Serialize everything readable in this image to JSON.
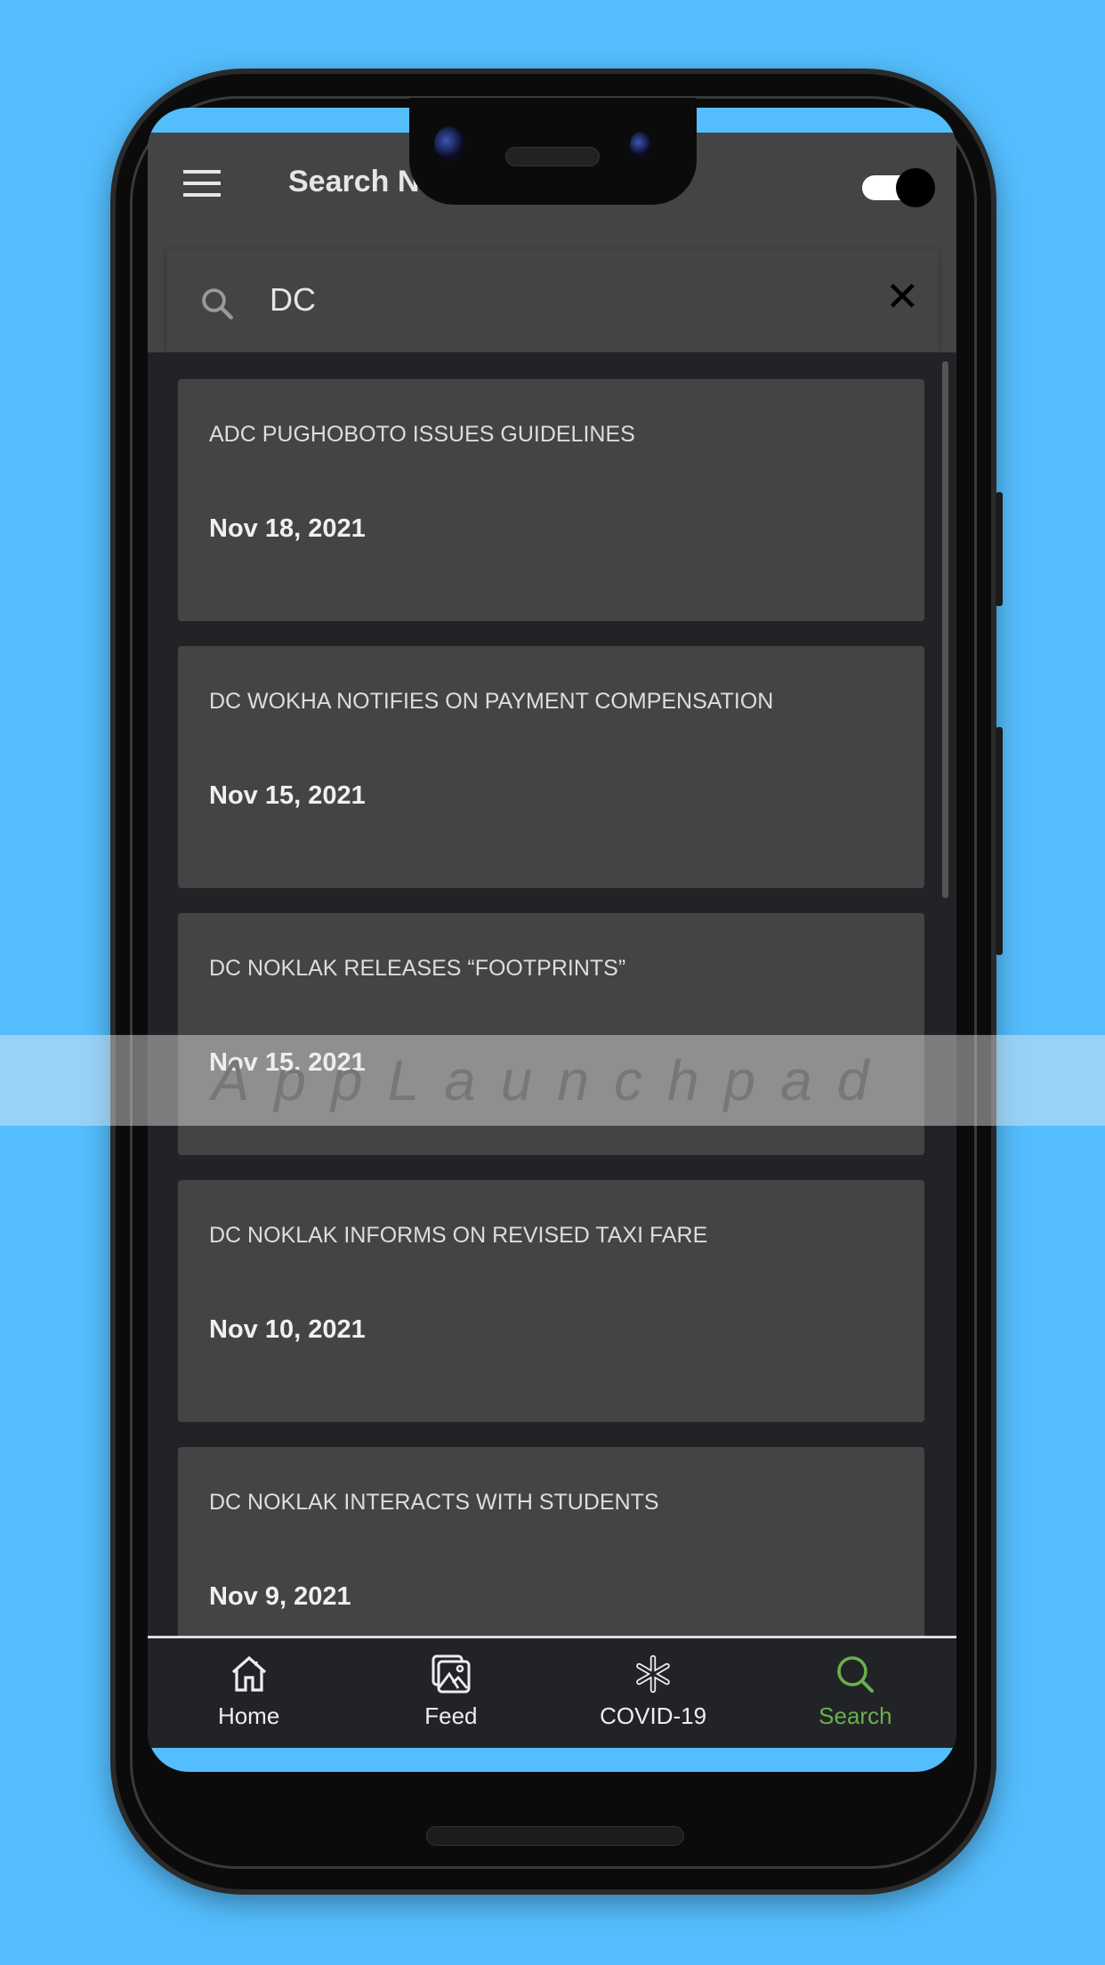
{
  "app_bar": {
    "title": "Search News",
    "dark_mode_toggle": true
  },
  "search": {
    "value": "DC",
    "icon": "search-icon",
    "clear_icon": "close-icon"
  },
  "results": [
    {
      "title": "ADC PUGHOBOTO ISSUES GUIDELINES",
      "date": "Nov 18, 2021"
    },
    {
      "title": "DC WOKHA NOTIFIES ON PAYMENT COMPENSATION",
      "date": "Nov 15, 2021"
    },
    {
      "title": "DC NOKLAK RELEASES “FOOTPRINTS”",
      "date": "Nov 15, 2021"
    },
    {
      "title": "DC NOKLAK INFORMS ON REVISED TAXI FARE",
      "date": "Nov 10, 2021"
    },
    {
      "title": "DC NOKLAK INTERACTS WITH STUDENTS",
      "date": "Nov 9, 2021"
    }
  ],
  "nav": [
    {
      "label": "Home",
      "icon": "home-icon"
    },
    {
      "label": "Feed",
      "icon": "gallery-icon"
    },
    {
      "label": "COVID-19",
      "icon": "asterisk-icon"
    },
    {
      "label": "Search",
      "icon": "search-icon",
      "active": true
    }
  ],
  "watermark": "AppLaunchpad",
  "colors": {
    "background": "#54bdfd",
    "accent": "#6ab04c",
    "card": "#444444",
    "list_bg": "#222326"
  }
}
